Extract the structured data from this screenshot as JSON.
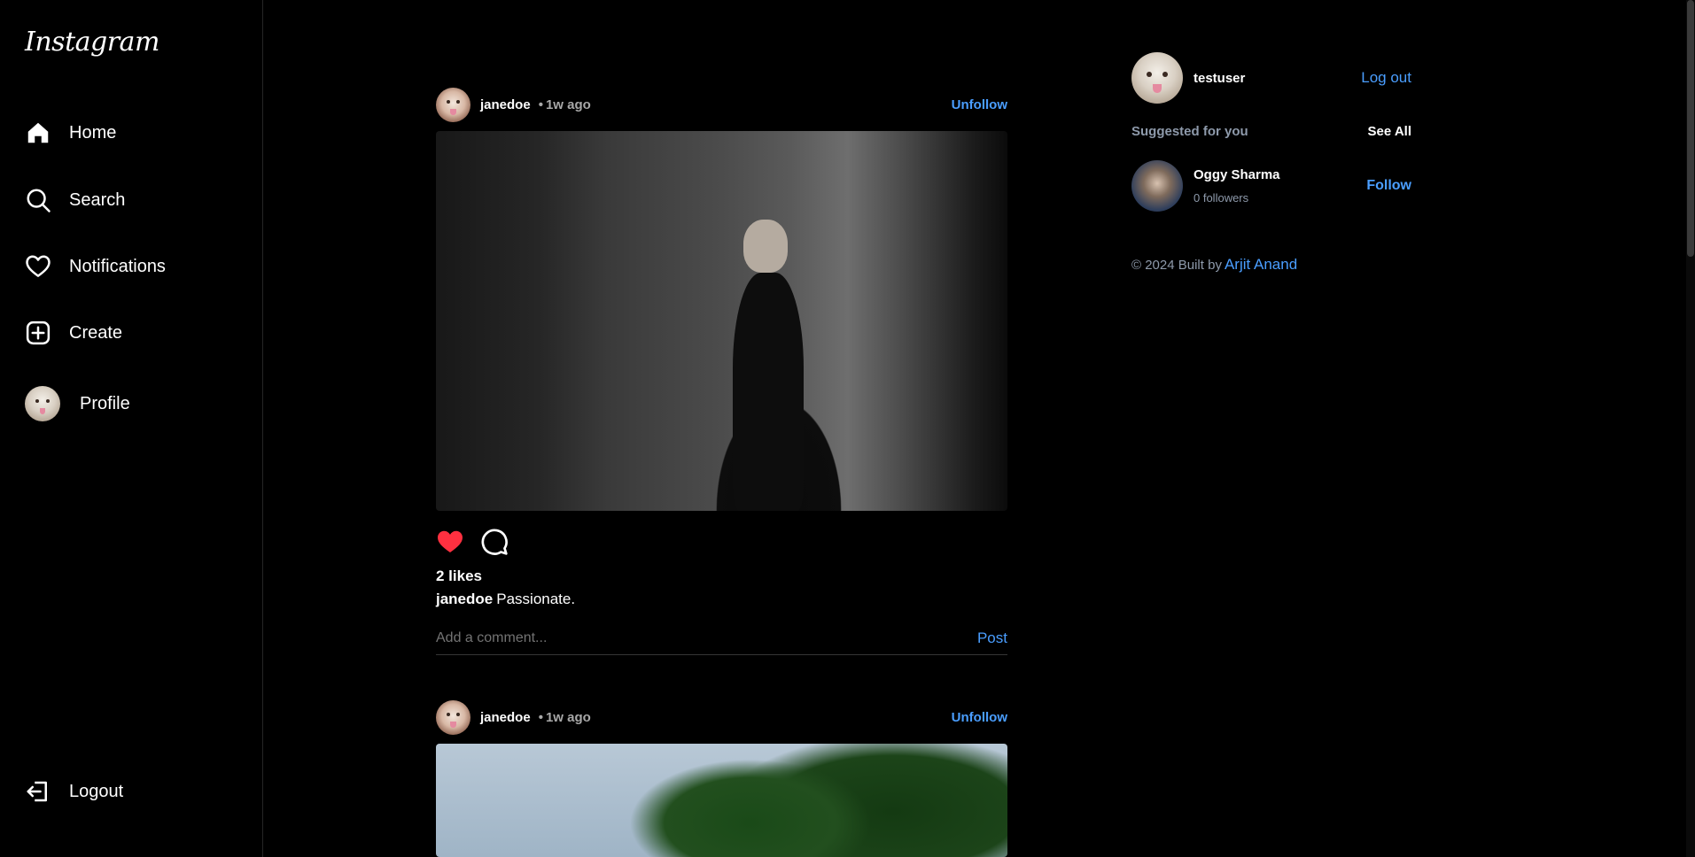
{
  "app": {
    "logo": "Instagram"
  },
  "sidebar": {
    "items": [
      {
        "label": "Home",
        "icon": "home-icon"
      },
      {
        "label": "Search",
        "icon": "search-icon"
      },
      {
        "label": "Notifications",
        "icon": "heart-icon"
      },
      {
        "label": "Create",
        "icon": "plus-square-icon"
      },
      {
        "label": "Profile",
        "icon": "avatar"
      }
    ],
    "logout_label": "Logout"
  },
  "feed": {
    "posts": [
      {
        "username": "janedoe",
        "dot": "•",
        "time": "1w ago",
        "unfollow_label": "Unfollow",
        "likes": "2 likes",
        "caption_user": "janedoe",
        "caption_text": "Passionate.",
        "liked": true,
        "comment_placeholder": "Add a comment...",
        "post_label": "Post"
      },
      {
        "username": "janedoe",
        "dot": "•",
        "time": "1w ago",
        "unfollow_label": "Unfollow"
      }
    ]
  },
  "right": {
    "me": {
      "username": "testuser",
      "logout_label": "Log out"
    },
    "suggested": {
      "title": "Suggested for you",
      "see_all": "See All",
      "users": [
        {
          "name": "Oggy Sharma",
          "followers": "0 followers",
          "follow_label": "Follow"
        }
      ]
    },
    "footer": {
      "text": "© 2024 Built by",
      "author": "Arjit Anand"
    }
  },
  "colors": {
    "accent": "#4a9eff",
    "like": "#ff3040",
    "background": "#000000"
  }
}
